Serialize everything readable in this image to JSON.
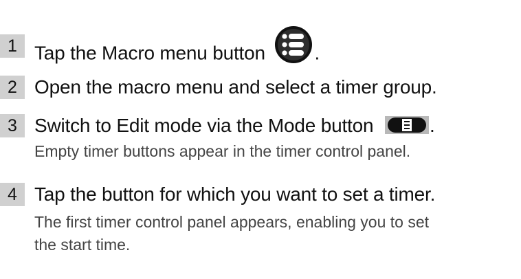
{
  "steps": [
    {
      "number": "1",
      "title": "Tap the Macro menu button",
      "suffix": ".",
      "icon": "macro-menu-icon"
    },
    {
      "number": "2",
      "title": "Open the macro menu and select a timer group."
    },
    {
      "number": "3",
      "title": "Switch to Edit mode via the Mode button",
      "suffix": ".",
      "icon": "mode-button-icon",
      "note": "Empty timer buttons appear in the timer control panel."
    },
    {
      "number": "4",
      "title": "Tap the button for which you want to set a timer.",
      "note_lines": [
        "The first timer control panel appears, enabling you to set",
        "the start time."
      ]
    }
  ]
}
